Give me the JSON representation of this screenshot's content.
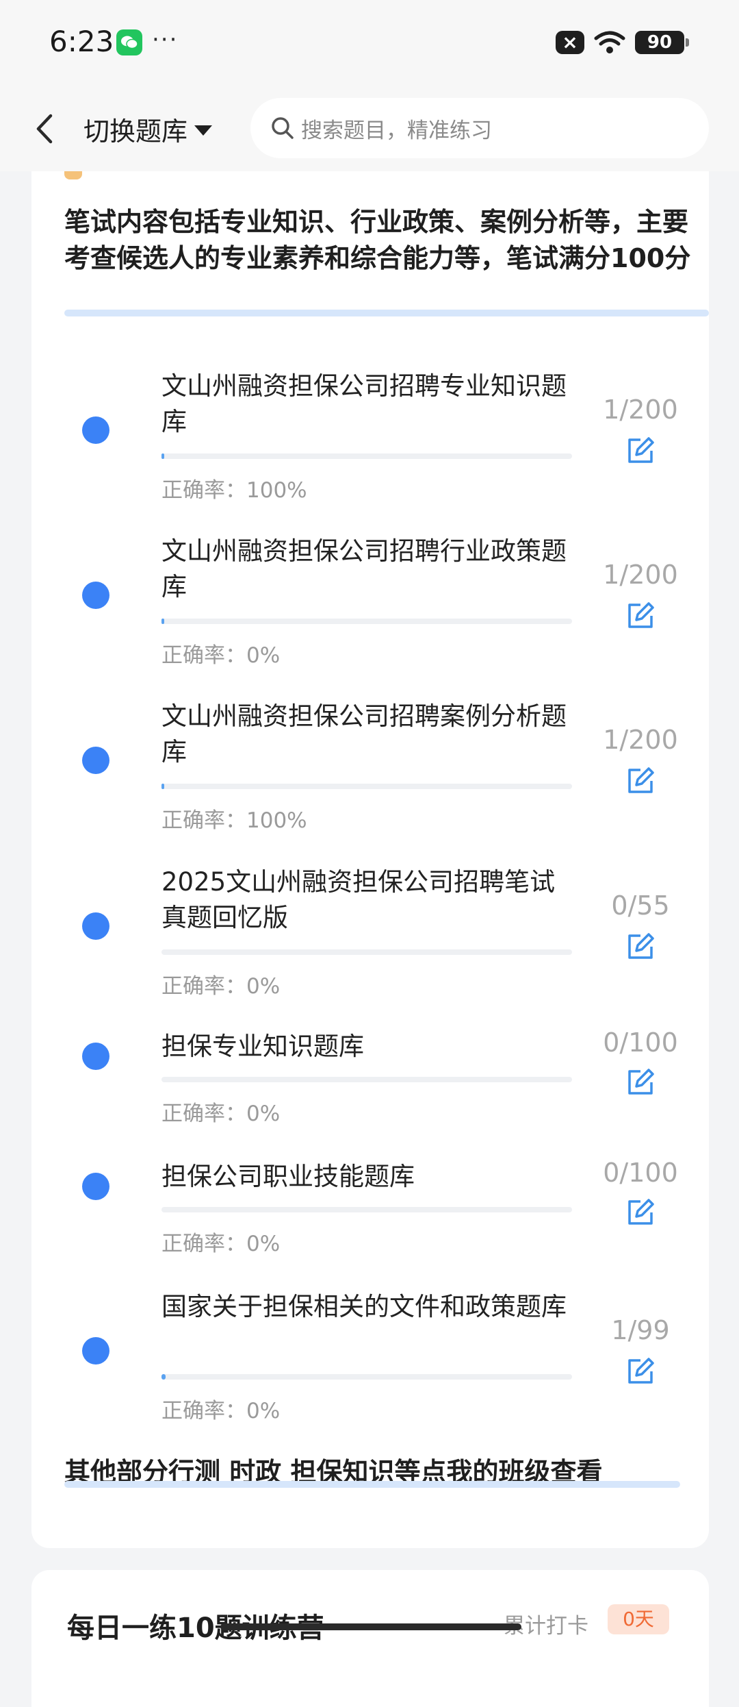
{
  "status_bar": {
    "time": "6:23",
    "dots": "···",
    "battery": "90"
  },
  "header": {
    "switch_label": "切换题库",
    "search_placeholder": "搜索题目，精准练习"
  },
  "intro": "笔试内容包括专业知识、行业政策、案例分析等，主要考查候选人的专业素养和综合能力等，笔试满分100分",
  "items": [
    {
      "title": "文山州融资担保公司招聘专业知识题库",
      "count": "1/200",
      "accuracy": "正确率：100%",
      "progress": 0.005
    },
    {
      "title": "文山州融资担保公司招聘行业政策题库",
      "count": "1/200",
      "accuracy": "正确率：0%",
      "progress": 0.005
    },
    {
      "title": "文山州融资担保公司招聘案例分析题库",
      "count": "1/200",
      "accuracy": "正确率：100%",
      "progress": 0.005
    },
    {
      "title": "2025文山州融资担保公司招聘笔试真题回忆版",
      "count": "0/55",
      "accuracy": "正确率：0%",
      "progress": 0
    },
    {
      "title": "担保专业知识题库",
      "count": "0/100",
      "accuracy": "正确率：0%",
      "progress": 0
    },
    {
      "title": "担保公司职业技能题库",
      "count": "0/100",
      "accuracy": "正确率：0%",
      "progress": 0
    },
    {
      "title": "国家关于担保相关的文件和政策题库",
      "count": "1/99",
      "accuracy": "正确率：0%",
      "progress": 0.01
    }
  ],
  "footer_text": "其他部分行测 时政 担保知识等点我的班级查看",
  "next_card": {
    "title": "每日一练10题训练营",
    "right_text": "累计打卡",
    "badge": "0天"
  },
  "colors": {
    "accent": "#3b82f6",
    "underline": "#d6e6fb"
  }
}
